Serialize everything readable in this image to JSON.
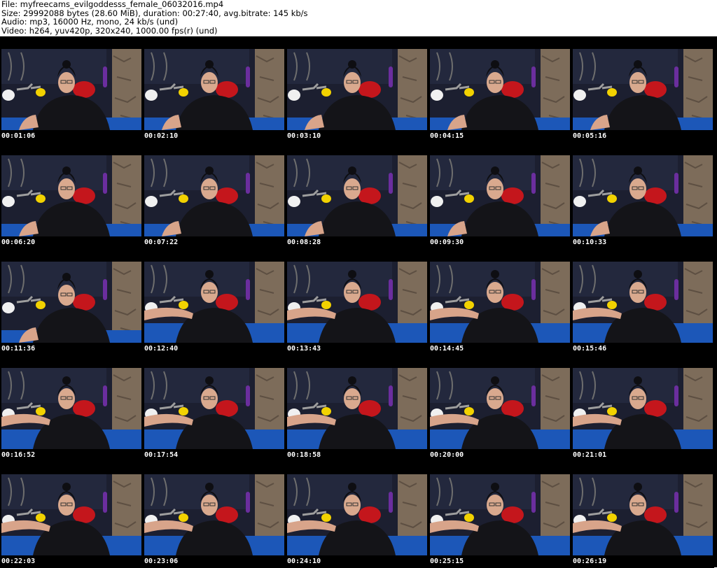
{
  "header": {
    "file_line": "File: myfreecams_evilgoddesss_female_06032016.mp4",
    "size_line": "Size: 29992088 bytes (28.60 MiB), duration: 00:27:40, avg.bitrate: 145 kb/s",
    "audio_line": "Audio: mp3, 16000 Hz, mono, 24 kb/s (und)",
    "video_line": "Video: h264, yuv420p, 320x240, 1000.00 fps(r) (und)"
  },
  "thumbnails": [
    {
      "timestamp": "00:01:06",
      "scene": "a"
    },
    {
      "timestamp": "00:02:10",
      "scene": "a"
    },
    {
      "timestamp": "00:03:10",
      "scene": "a"
    },
    {
      "timestamp": "00:04:15",
      "scene": "a"
    },
    {
      "timestamp": "00:05:16",
      "scene": "a"
    },
    {
      "timestamp": "00:06:20",
      "scene": "a"
    },
    {
      "timestamp": "00:07:22",
      "scene": "a"
    },
    {
      "timestamp": "00:08:28",
      "scene": "a"
    },
    {
      "timestamp": "00:09:30",
      "scene": "a"
    },
    {
      "timestamp": "00:10:33",
      "scene": "a"
    },
    {
      "timestamp": "00:11:36",
      "scene": "a"
    },
    {
      "timestamp": "00:12:40",
      "scene": "b"
    },
    {
      "timestamp": "00:13:43",
      "scene": "b"
    },
    {
      "timestamp": "00:14:45",
      "scene": "b"
    },
    {
      "timestamp": "00:15:46",
      "scene": "b"
    },
    {
      "timestamp": "00:16:52",
      "scene": "b"
    },
    {
      "timestamp": "00:17:54",
      "scene": "b"
    },
    {
      "timestamp": "00:18:58",
      "scene": "b"
    },
    {
      "timestamp": "00:20:00",
      "scene": "b"
    },
    {
      "timestamp": "00:21:01",
      "scene": "b"
    },
    {
      "timestamp": "00:22:03",
      "scene": "b"
    },
    {
      "timestamp": "00:23:06",
      "scene": "b"
    },
    {
      "timestamp": "00:24:10",
      "scene": "b"
    },
    {
      "timestamp": "00:25:15",
      "scene": "b"
    },
    {
      "timestamp": "00:26:19",
      "scene": "b"
    }
  ]
}
